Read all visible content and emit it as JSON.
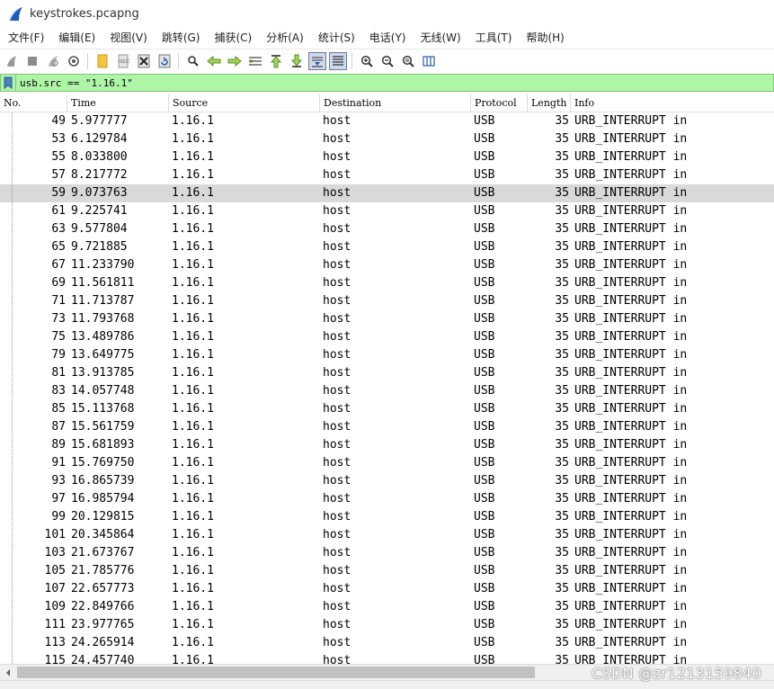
{
  "window": {
    "title": "keystrokes.pcapng"
  },
  "menubar": {
    "items": [
      {
        "label": "文件(F)"
      },
      {
        "label": "编辑(E)"
      },
      {
        "label": "视图(V)"
      },
      {
        "label": "跳转(G)"
      },
      {
        "label": "捕获(C)"
      },
      {
        "label": "分析(A)"
      },
      {
        "label": "统计(S)"
      },
      {
        "label": "电话(Y)"
      },
      {
        "label": "无线(W)"
      },
      {
        "label": "工具(T)"
      },
      {
        "label": "帮助(H)"
      }
    ]
  },
  "toolbar": {
    "icons": [
      "start-capture-icon",
      "stop-capture-icon",
      "restart-capture-icon",
      "capture-options-icon",
      "open-file-icon",
      "save-file-icon",
      "close-file-icon",
      "reload-file-icon",
      "find-packet-icon",
      "go-back-icon",
      "go-forward-icon",
      "go-to-packet-icon",
      "go-first-icon",
      "go-last-icon",
      "autoscroll-icon",
      "colorize-icon",
      "zoom-in-icon",
      "zoom-out-icon",
      "normal-size-icon",
      "resize-columns-icon"
    ]
  },
  "filter": {
    "value": "usb.src == \"1.16.1\"",
    "bg_color": "#aff5a8"
  },
  "columns": {
    "no": "No.",
    "time": "Time",
    "source": "Source",
    "destination": "Destination",
    "protocol": "Protocol",
    "length": "Length",
    "info": "Info"
  },
  "packets": [
    {
      "no": "49",
      "time": "5.977777",
      "src": "1.16.1",
      "dst": "host",
      "proto": "USB",
      "len": "35",
      "info": "URB_INTERRUPT in"
    },
    {
      "no": "53",
      "time": "6.129784",
      "src": "1.16.1",
      "dst": "host",
      "proto": "USB",
      "len": "35",
      "info": "URB_INTERRUPT in"
    },
    {
      "no": "55",
      "time": "8.033800",
      "src": "1.16.1",
      "dst": "host",
      "proto": "USB",
      "len": "35",
      "info": "URB_INTERRUPT in"
    },
    {
      "no": "57",
      "time": "8.217772",
      "src": "1.16.1",
      "dst": "host",
      "proto": "USB",
      "len": "35",
      "info": "URB_INTERRUPT in"
    },
    {
      "no": "59",
      "time": "9.073763",
      "src": "1.16.1",
      "dst": "host",
      "proto": "USB",
      "len": "35",
      "info": "URB_INTERRUPT in",
      "selected": true
    },
    {
      "no": "61",
      "time": "9.225741",
      "src": "1.16.1",
      "dst": "host",
      "proto": "USB",
      "len": "35",
      "info": "URB_INTERRUPT in"
    },
    {
      "no": "63",
      "time": "9.577804",
      "src": "1.16.1",
      "dst": "host",
      "proto": "USB",
      "len": "35",
      "info": "URB_INTERRUPT in"
    },
    {
      "no": "65",
      "time": "9.721885",
      "src": "1.16.1",
      "dst": "host",
      "proto": "USB",
      "len": "35",
      "info": "URB_INTERRUPT in"
    },
    {
      "no": "67",
      "time": "11.233790",
      "src": "1.16.1",
      "dst": "host",
      "proto": "USB",
      "len": "35",
      "info": "URB_INTERRUPT in"
    },
    {
      "no": "69",
      "time": "11.561811",
      "src": "1.16.1",
      "dst": "host",
      "proto": "USB",
      "len": "35",
      "info": "URB_INTERRUPT in"
    },
    {
      "no": "71",
      "time": "11.713787",
      "src": "1.16.1",
      "dst": "host",
      "proto": "USB",
      "len": "35",
      "info": "URB_INTERRUPT in"
    },
    {
      "no": "73",
      "time": "11.793768",
      "src": "1.16.1",
      "dst": "host",
      "proto": "USB",
      "len": "35",
      "info": "URB_INTERRUPT in"
    },
    {
      "no": "75",
      "time": "13.489786",
      "src": "1.16.1",
      "dst": "host",
      "proto": "USB",
      "len": "35",
      "info": "URB_INTERRUPT in"
    },
    {
      "no": "79",
      "time": "13.649775",
      "src": "1.16.1",
      "dst": "host",
      "proto": "USB",
      "len": "35",
      "info": "URB_INTERRUPT in"
    },
    {
      "no": "81",
      "time": "13.913785",
      "src": "1.16.1",
      "dst": "host",
      "proto": "USB",
      "len": "35",
      "info": "URB_INTERRUPT in"
    },
    {
      "no": "83",
      "time": "14.057748",
      "src": "1.16.1",
      "dst": "host",
      "proto": "USB",
      "len": "35",
      "info": "URB_INTERRUPT in"
    },
    {
      "no": "85",
      "time": "15.113768",
      "src": "1.16.1",
      "dst": "host",
      "proto": "USB",
      "len": "35",
      "info": "URB_INTERRUPT in"
    },
    {
      "no": "87",
      "time": "15.561759",
      "src": "1.16.1",
      "dst": "host",
      "proto": "USB",
      "len": "35",
      "info": "URB_INTERRUPT in"
    },
    {
      "no": "89",
      "time": "15.681893",
      "src": "1.16.1",
      "dst": "host",
      "proto": "USB",
      "len": "35",
      "info": "URB_INTERRUPT in"
    },
    {
      "no": "91",
      "time": "15.769750",
      "src": "1.16.1",
      "dst": "host",
      "proto": "USB",
      "len": "35",
      "info": "URB_INTERRUPT in"
    },
    {
      "no": "93",
      "time": "16.865739",
      "src": "1.16.1",
      "dst": "host",
      "proto": "USB",
      "len": "35",
      "info": "URB_INTERRUPT in"
    },
    {
      "no": "97",
      "time": "16.985794",
      "src": "1.16.1",
      "dst": "host",
      "proto": "USB",
      "len": "35",
      "info": "URB_INTERRUPT in"
    },
    {
      "no": "99",
      "time": "20.129815",
      "src": "1.16.1",
      "dst": "host",
      "proto": "USB",
      "len": "35",
      "info": "URB_INTERRUPT in"
    },
    {
      "no": "101",
      "time": "20.345864",
      "src": "1.16.1",
      "dst": "host",
      "proto": "USB",
      "len": "35",
      "info": "URB_INTERRUPT in"
    },
    {
      "no": "103",
      "time": "21.673767",
      "src": "1.16.1",
      "dst": "host",
      "proto": "USB",
      "len": "35",
      "info": "URB_INTERRUPT in"
    },
    {
      "no": "105",
      "time": "21.785776",
      "src": "1.16.1",
      "dst": "host",
      "proto": "USB",
      "len": "35",
      "info": "URB_INTERRUPT in"
    },
    {
      "no": "107",
      "time": "22.657773",
      "src": "1.16.1",
      "dst": "host",
      "proto": "USB",
      "len": "35",
      "info": "URB_INTERRUPT in"
    },
    {
      "no": "109",
      "time": "22.849766",
      "src": "1.16.1",
      "dst": "host",
      "proto": "USB",
      "len": "35",
      "info": "URB_INTERRUPT in"
    },
    {
      "no": "111",
      "time": "23.977765",
      "src": "1.16.1",
      "dst": "host",
      "proto": "USB",
      "len": "35",
      "info": "URB_INTERRUPT in"
    },
    {
      "no": "113",
      "time": "24.265914",
      "src": "1.16.1",
      "dst": "host",
      "proto": "USB",
      "len": "35",
      "info": "URB_INTERRUPT in"
    },
    {
      "no": "115",
      "time": "24.457740",
      "src": "1.16.1",
      "dst": "host",
      "proto": "USB",
      "len": "35",
      "info": "URB_INTERRUPT in"
    }
  ],
  "watermark": {
    "text": "CSDN @zr1213159840"
  }
}
